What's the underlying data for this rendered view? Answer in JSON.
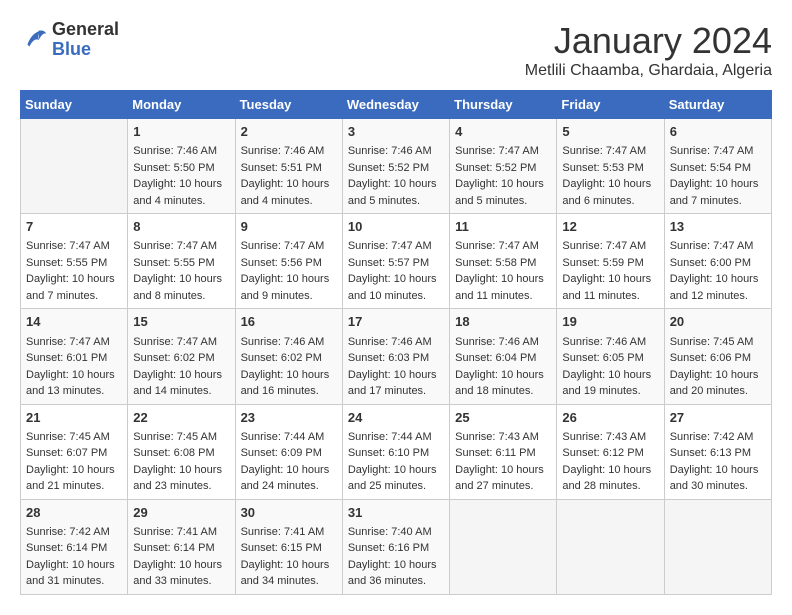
{
  "header": {
    "logo": {
      "general": "General",
      "blue": "Blue"
    },
    "title": "January 2024",
    "subtitle": "Metlili Chaamba, Ghardaia, Algeria"
  },
  "calendar": {
    "days_of_week": [
      "Sunday",
      "Monday",
      "Tuesday",
      "Wednesday",
      "Thursday",
      "Friday",
      "Saturday"
    ],
    "weeks": [
      [
        {
          "day": null,
          "info": null
        },
        {
          "day": "1",
          "info": "Sunrise: 7:46 AM\nSunset: 5:50 PM\nDaylight: 10 hours\nand 4 minutes."
        },
        {
          "day": "2",
          "info": "Sunrise: 7:46 AM\nSunset: 5:51 PM\nDaylight: 10 hours\nand 4 minutes."
        },
        {
          "day": "3",
          "info": "Sunrise: 7:46 AM\nSunset: 5:52 PM\nDaylight: 10 hours\nand 5 minutes."
        },
        {
          "day": "4",
          "info": "Sunrise: 7:47 AM\nSunset: 5:52 PM\nDaylight: 10 hours\nand 5 minutes."
        },
        {
          "day": "5",
          "info": "Sunrise: 7:47 AM\nSunset: 5:53 PM\nDaylight: 10 hours\nand 6 minutes."
        },
        {
          "day": "6",
          "info": "Sunrise: 7:47 AM\nSunset: 5:54 PM\nDaylight: 10 hours\nand 7 minutes."
        }
      ],
      [
        {
          "day": "7",
          "info": "Sunrise: 7:47 AM\nSunset: 5:55 PM\nDaylight: 10 hours\nand 7 minutes."
        },
        {
          "day": "8",
          "info": "Sunrise: 7:47 AM\nSunset: 5:55 PM\nDaylight: 10 hours\nand 8 minutes."
        },
        {
          "day": "9",
          "info": "Sunrise: 7:47 AM\nSunset: 5:56 PM\nDaylight: 10 hours\nand 9 minutes."
        },
        {
          "day": "10",
          "info": "Sunrise: 7:47 AM\nSunset: 5:57 PM\nDaylight: 10 hours\nand 10 minutes."
        },
        {
          "day": "11",
          "info": "Sunrise: 7:47 AM\nSunset: 5:58 PM\nDaylight: 10 hours\nand 11 minutes."
        },
        {
          "day": "12",
          "info": "Sunrise: 7:47 AM\nSunset: 5:59 PM\nDaylight: 10 hours\nand 11 minutes."
        },
        {
          "day": "13",
          "info": "Sunrise: 7:47 AM\nSunset: 6:00 PM\nDaylight: 10 hours\nand 12 minutes."
        }
      ],
      [
        {
          "day": "14",
          "info": "Sunrise: 7:47 AM\nSunset: 6:01 PM\nDaylight: 10 hours\nand 13 minutes."
        },
        {
          "day": "15",
          "info": "Sunrise: 7:47 AM\nSunset: 6:02 PM\nDaylight: 10 hours\nand 14 minutes."
        },
        {
          "day": "16",
          "info": "Sunrise: 7:46 AM\nSunset: 6:02 PM\nDaylight: 10 hours\nand 16 minutes."
        },
        {
          "day": "17",
          "info": "Sunrise: 7:46 AM\nSunset: 6:03 PM\nDaylight: 10 hours\nand 17 minutes."
        },
        {
          "day": "18",
          "info": "Sunrise: 7:46 AM\nSunset: 6:04 PM\nDaylight: 10 hours\nand 18 minutes."
        },
        {
          "day": "19",
          "info": "Sunrise: 7:46 AM\nSunset: 6:05 PM\nDaylight: 10 hours\nand 19 minutes."
        },
        {
          "day": "20",
          "info": "Sunrise: 7:45 AM\nSunset: 6:06 PM\nDaylight: 10 hours\nand 20 minutes."
        }
      ],
      [
        {
          "day": "21",
          "info": "Sunrise: 7:45 AM\nSunset: 6:07 PM\nDaylight: 10 hours\nand 21 minutes."
        },
        {
          "day": "22",
          "info": "Sunrise: 7:45 AM\nSunset: 6:08 PM\nDaylight: 10 hours\nand 23 minutes."
        },
        {
          "day": "23",
          "info": "Sunrise: 7:44 AM\nSunset: 6:09 PM\nDaylight: 10 hours\nand 24 minutes."
        },
        {
          "day": "24",
          "info": "Sunrise: 7:44 AM\nSunset: 6:10 PM\nDaylight: 10 hours\nand 25 minutes."
        },
        {
          "day": "25",
          "info": "Sunrise: 7:43 AM\nSunset: 6:11 PM\nDaylight: 10 hours\nand 27 minutes."
        },
        {
          "day": "26",
          "info": "Sunrise: 7:43 AM\nSunset: 6:12 PM\nDaylight: 10 hours\nand 28 minutes."
        },
        {
          "day": "27",
          "info": "Sunrise: 7:42 AM\nSunset: 6:13 PM\nDaylight: 10 hours\nand 30 minutes."
        }
      ],
      [
        {
          "day": "28",
          "info": "Sunrise: 7:42 AM\nSunset: 6:14 PM\nDaylight: 10 hours\nand 31 minutes."
        },
        {
          "day": "29",
          "info": "Sunrise: 7:41 AM\nSunset: 6:14 PM\nDaylight: 10 hours\nand 33 minutes."
        },
        {
          "day": "30",
          "info": "Sunrise: 7:41 AM\nSunset: 6:15 PM\nDaylight: 10 hours\nand 34 minutes."
        },
        {
          "day": "31",
          "info": "Sunrise: 7:40 AM\nSunset: 6:16 PM\nDaylight: 10 hours\nand 36 minutes."
        },
        {
          "day": null,
          "info": null
        },
        {
          "day": null,
          "info": null
        },
        {
          "day": null,
          "info": null
        }
      ]
    ]
  }
}
